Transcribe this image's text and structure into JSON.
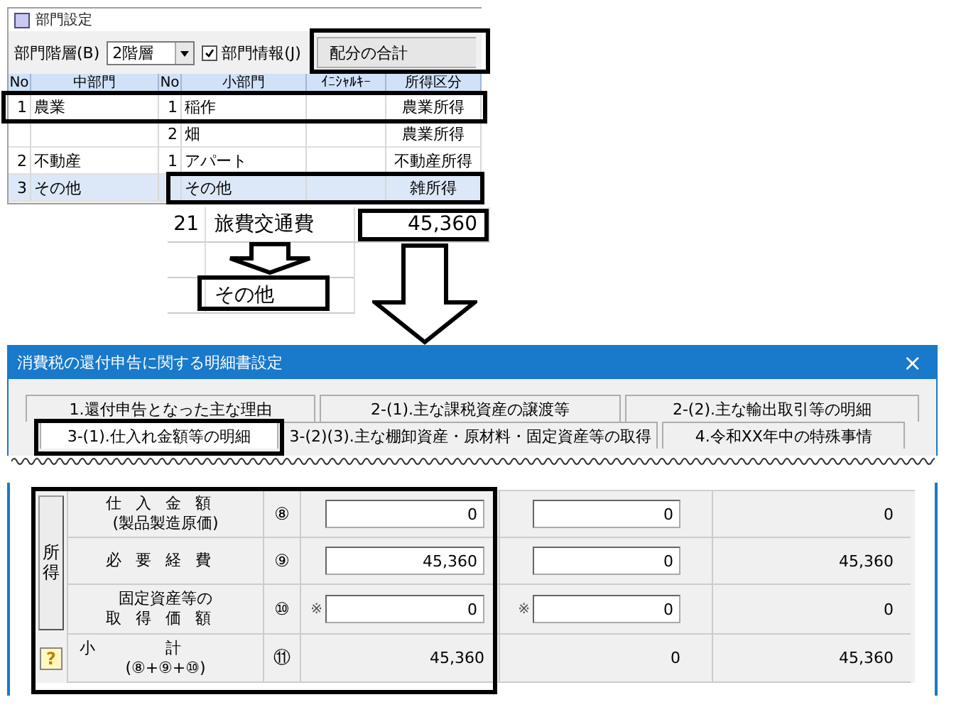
{
  "department_dialog": {
    "title": "部門設定",
    "hierarchy_label": "部門階層(B)",
    "hierarchy_value": "2階層",
    "department_info": {
      "label": "部門情報(J)",
      "checked": true
    },
    "allocation_button": "配分の合計",
    "columns": [
      "No",
      "中部門",
      "No",
      "小部門",
      "ｲﾆｼｬﾙｷｰ",
      "所得区分"
    ],
    "rows": [
      {
        "no": "1",
        "middle": "農業",
        "sub_no": "1",
        "sub": "稲作",
        "income_class": "農業所得",
        "selected": false
      },
      {
        "sub_no": "2",
        "sub": "畑",
        "income_class": "農業所得",
        "selected": false
      },
      {
        "no": "2",
        "middle": "不動産",
        "sub_no": "1",
        "sub": "アパート",
        "income_class": "不動産所得",
        "selected": false
      },
      {
        "no": "3",
        "middle": "その他",
        "sub": "その他",
        "income_class": "雑所得",
        "selected": true
      }
    ]
  },
  "expense_list": {
    "rows": [
      {
        "no": "21",
        "name": "旅費交通費",
        "amount": "45,360"
      },
      {},
      {
        "name": "その他"
      }
    ]
  },
  "statement_window": {
    "title": "消費税の還付申告に関する明細書設定",
    "close": "×",
    "tab_rows": [
      [
        {
          "label": "1.還付申告となった主な理由",
          "selected": false
        },
        {
          "label": "2-(1).主な課税資産の譲渡等",
          "selected": false
        },
        {
          "label": "2-(2).主な輸出取引等の明細",
          "selected": false
        }
      ],
      [
        {
          "label": "3-(1).仕入れ金額等の明細",
          "selected": true
        },
        {
          "label": "3-(2)(3).主な棚卸資産・原材料・固定資産等の取得",
          "selected": false
        },
        {
          "label": "4.令和XX年中の特殊事情",
          "selected": false
        }
      ]
    ]
  },
  "income_table": {
    "group_label": "所得",
    "help": "?",
    "rows": [
      {
        "label_lines": [
          "仕入金額",
          "(製品製造原価)"
        ],
        "number": "⑧",
        "cells": [
          {
            "kind": "input",
            "value": "0"
          },
          {
            "kind": "input",
            "value": "0"
          },
          {
            "kind": "text",
            "value": "0"
          }
        ]
      },
      {
        "label_lines": [
          "必要経費"
        ],
        "number": "⑨",
        "cells": [
          {
            "kind": "input",
            "value": "45,360"
          },
          {
            "kind": "input",
            "value": "0"
          },
          {
            "kind": "text",
            "value": "45,360"
          }
        ]
      },
      {
        "label_lines": [
          "固定資産等の",
          "取得価額"
        ],
        "number": "⑩",
        "cells": [
          {
            "kind": "input",
            "value": "0",
            "mark": "※"
          },
          {
            "kind": "input",
            "value": "0",
            "mark": "※"
          },
          {
            "kind": "text",
            "value": "0"
          }
        ]
      },
      {
        "label_lines": [
          "小計",
          "(⑧+⑨+⑩)"
        ],
        "number": "⑪",
        "cells": [
          {
            "kind": "text",
            "value": "45,360"
          },
          {
            "kind": "text",
            "value": "0"
          },
          {
            "kind": "text",
            "value": "45,360"
          }
        ]
      }
    ]
  }
}
